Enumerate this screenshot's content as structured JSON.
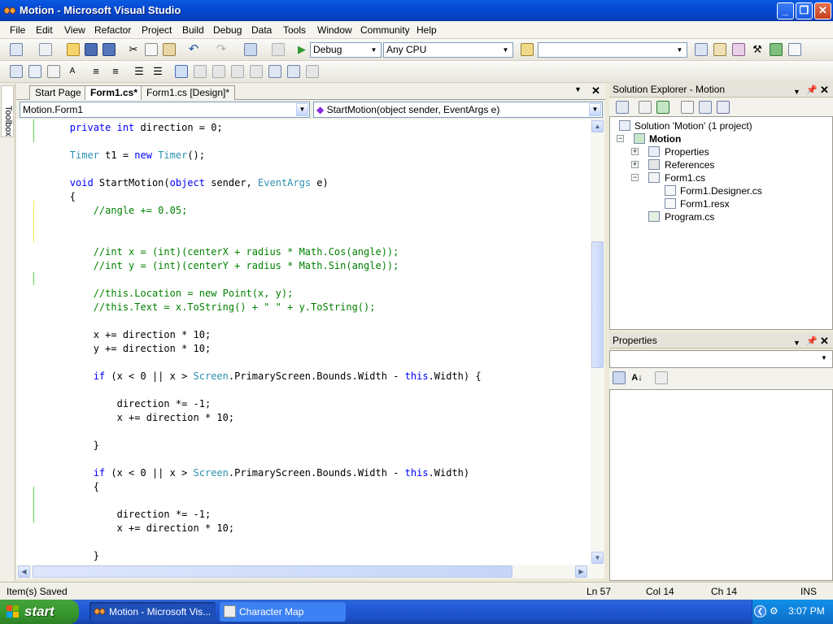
{
  "window": {
    "title": "Motion - Microsoft Visual Studio"
  },
  "menu": [
    "File",
    "Edit",
    "View",
    "Refactor",
    "Project",
    "Build",
    "Debug",
    "Data",
    "Tools",
    "Window",
    "Community",
    "Help"
  ],
  "toolbar": {
    "config": "Debug",
    "platform": "Any CPU",
    "find": ""
  },
  "toolbox_label": "Toolbox",
  "editor": {
    "tabs": [
      {
        "label": "Start Page",
        "active": false
      },
      {
        "label": "Form1.cs*",
        "active": true
      },
      {
        "label": "Form1.cs [Design]*",
        "active": false
      }
    ],
    "type_combo": "Motion.Form1",
    "member_combo": "StartMotion(object sender, EventArgs e)",
    "code_lines": [
      "        private int direction = 0;",
      "",
      "        Timer t1 = new Timer();",
      "",
      "        void StartMotion(object sender, EventArgs e)",
      "        {",
      "            //angle += 0.05;",
      "",
      "",
      "            //int x = (int)(centerX + radius * Math.Cos(angle));",
      "            //int y = (int)(centerY + radius * Math.Sin(angle));",
      "",
      "            //this.Location = new Point(x, y);",
      "            //this.Text = x.ToString() + \" \" + y.ToString();",
      "",
      "            x += direction * 10;",
      "            y += direction * 10;",
      "",
      "            if (x < 0 || x > Screen.PrimaryScreen.Bounds.Width - this.Width) {",
      "",
      "                direction *= -1;",
      "                x += direction * 10;",
      "",
      "            }",
      "",
      "            if (x < 0 || x > Screen.PrimaryScreen.Bounds.Width - this.Width)",
      "            {",
      "",
      "                direction *= -1;",
      "                x += direction * 10;",
      "",
      "            }"
    ]
  },
  "solution_explorer": {
    "title": "Solution Explorer - Motion",
    "items": [
      "Solution 'Motion' (1 project)",
      "Motion",
      "Properties",
      "References",
      "Form1.cs",
      "Form1.Designer.cs",
      "Form1.resx",
      "Program.cs"
    ]
  },
  "properties": {
    "title": "Properties"
  },
  "status": {
    "message": "Item(s) Saved",
    "ln": "Ln 57",
    "col": "Col 14",
    "ch": "Ch 14",
    "mode": "INS"
  },
  "taskbar": {
    "start": "start",
    "tasks": [
      "Motion - Microsoft Vis...",
      "Character Map"
    ],
    "clock": "3:07 PM"
  },
  "colors": {
    "keyword": "#0000ff",
    "type": "#2b91af",
    "comment": "#008000",
    "titlebar": "#0549d4",
    "changed_margin": "#5bd64e",
    "unsaved_margin": "#f2e65a"
  }
}
